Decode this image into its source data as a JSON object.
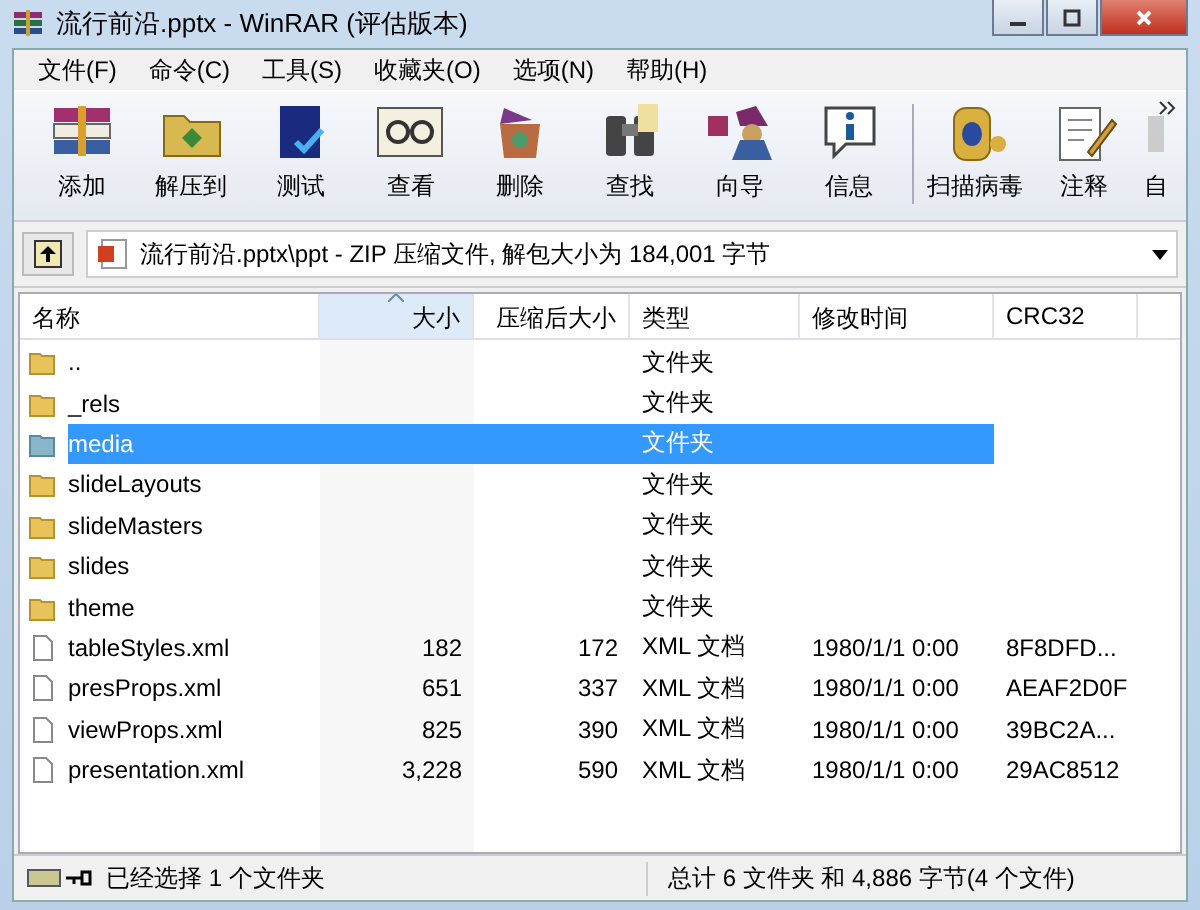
{
  "window": {
    "title": "流行前沿.pptx - WinRAR (评估版本)"
  },
  "menu": [
    "文件(F)",
    "命令(C)",
    "工具(S)",
    "收藏夹(O)",
    "选项(N)",
    "帮助(H)"
  ],
  "toolbar": [
    {
      "label": "添加",
      "kind": "archive"
    },
    {
      "label": "解压到",
      "kind": "extract"
    },
    {
      "label": "测试",
      "kind": "test"
    },
    {
      "label": "查看",
      "kind": "view"
    },
    {
      "label": "删除",
      "kind": "delete"
    },
    {
      "label": "查找",
      "kind": "find"
    },
    {
      "label": "向导",
      "kind": "wizard"
    },
    {
      "label": "信息",
      "kind": "info"
    },
    {
      "label": "扫描病毒",
      "kind": "scan"
    },
    {
      "label": "注释",
      "kind": "comment"
    },
    {
      "label": "自",
      "kind": "more"
    }
  ],
  "address": {
    "path": "流行前沿.pptx\\ppt - ZIP 压缩文件, 解包大小为 184,001 字节"
  },
  "table": {
    "columns": [
      {
        "label": "名称",
        "sorted": false
      },
      {
        "label": "大小",
        "sorted": true
      },
      {
        "label": "压缩后大小",
        "sorted": false
      },
      {
        "label": "类型",
        "sorted": false
      },
      {
        "label": "修改时间",
        "sorted": false
      },
      {
        "label": "CRC32",
        "sorted": false
      }
    ],
    "rows": [
      {
        "kind": "folder",
        "selected": false,
        "cells": [
          "..",
          "",
          "",
          "文件夹",
          "",
          ""
        ]
      },
      {
        "kind": "folder",
        "selected": false,
        "cells": [
          "_rels",
          "",
          "",
          "文件夹",
          "",
          ""
        ]
      },
      {
        "kind": "folder",
        "selected": true,
        "cells": [
          "media",
          "",
          "",
          "文件夹",
          "",
          ""
        ]
      },
      {
        "kind": "folder",
        "selected": false,
        "cells": [
          "slideLayouts",
          "",
          "",
          "文件夹",
          "",
          ""
        ]
      },
      {
        "kind": "folder",
        "selected": false,
        "cells": [
          "slideMasters",
          "",
          "",
          "文件夹",
          "",
          ""
        ]
      },
      {
        "kind": "folder",
        "selected": false,
        "cells": [
          "slides",
          "",
          "",
          "文件夹",
          "",
          ""
        ]
      },
      {
        "kind": "folder",
        "selected": false,
        "cells": [
          "theme",
          "",
          "",
          "文件夹",
          "",
          ""
        ]
      },
      {
        "kind": "file",
        "selected": false,
        "cells": [
          "tableStyles.xml",
          "182",
          "172",
          "XML 文档",
          "1980/1/1 0:00",
          "8F8DFD..."
        ]
      },
      {
        "kind": "file",
        "selected": false,
        "cells": [
          "presProps.xml",
          "651",
          "337",
          "XML 文档",
          "1980/1/1 0:00",
          "AEAF2D0F"
        ]
      },
      {
        "kind": "file",
        "selected": false,
        "cells": [
          "viewProps.xml",
          "825",
          "390",
          "XML 文档",
          "1980/1/1 0:00",
          "39BC2A..."
        ]
      },
      {
        "kind": "file",
        "selected": false,
        "cells": [
          "presentation.xml",
          "3,228",
          "590",
          "XML 文档",
          "1980/1/1 0:00",
          "29AC8512"
        ]
      }
    ]
  },
  "status_bar": {
    "left": "已经选择 1 个文件夹",
    "right": "总计 6 文件夹 和 4,886 字节(4 个文件)"
  }
}
